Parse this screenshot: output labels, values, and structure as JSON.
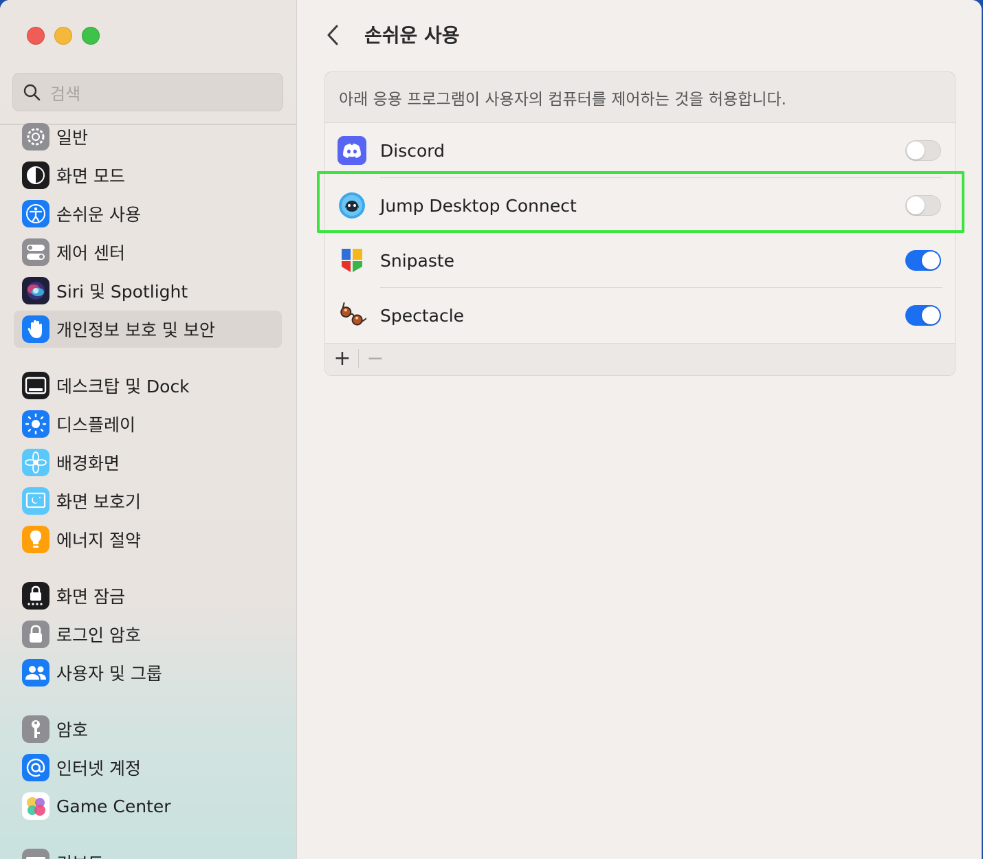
{
  "sidebar": {
    "search_placeholder": "검색",
    "items": [
      {
        "label": "일반",
        "icon": "gear-icon",
        "color": "#8e8e93"
      },
      {
        "label": "화면 모드",
        "icon": "appearance-icon",
        "color": "#1c1c1e"
      },
      {
        "label": "손쉬운 사용",
        "icon": "accessibility-icon",
        "color": "#1a7cf5"
      },
      {
        "label": "제어 센터",
        "icon": "control-center-icon",
        "color": "#8e8e93"
      },
      {
        "label": "Siri 및 Spotlight",
        "icon": "siri-icon",
        "color": "#2b2b5e"
      },
      {
        "label": "개인정보 보호 및 보안",
        "icon": "hand-icon",
        "color": "#1a7cf5",
        "selected": true
      },
      {
        "label": "데스크탑 및 Dock",
        "icon": "dock-icon",
        "color": "#1c1c1e"
      },
      {
        "label": "디스플레이",
        "icon": "display-icon",
        "color": "#1a7cf5"
      },
      {
        "label": "배경화면",
        "icon": "wallpaper-icon",
        "color": "#5ac8fa"
      },
      {
        "label": "화면 보호기",
        "icon": "screensaver-icon",
        "color": "#5ac8fa"
      },
      {
        "label": "에너지 절약",
        "icon": "energy-icon",
        "color": "#ff9f0a"
      },
      {
        "label": "화면 잠금",
        "icon": "lock-screen-icon",
        "color": "#1c1c1e"
      },
      {
        "label": "로그인 암호",
        "icon": "login-lock-icon",
        "color": "#8e8e93"
      },
      {
        "label": "사용자 및 그룹",
        "icon": "users-icon",
        "color": "#1a7cf5"
      },
      {
        "label": "암호",
        "icon": "key-icon",
        "color": "#8e8e93"
      },
      {
        "label": "인터넷 계정",
        "icon": "at-icon",
        "color": "#1a7cf5"
      },
      {
        "label": "Game Center",
        "icon": "game-center-icon",
        "color": "#ffffff"
      },
      {
        "label": "키보드",
        "icon": "keyboard-icon",
        "color": "#8e8e93"
      }
    ]
  },
  "main": {
    "title": "손쉬운 사용",
    "description": "아래 응용 프로그램이 사용자의 컴퓨터를 제어하는 것을 허용합니다.",
    "apps": [
      {
        "name": "Discord",
        "icon": "discord-icon",
        "enabled": false
      },
      {
        "name": "Jump Desktop Connect",
        "icon": "jump-desktop-icon",
        "enabled": false
      },
      {
        "name": "Snipaste",
        "icon": "snipaste-icon",
        "enabled": true
      },
      {
        "name": "Spectacle",
        "icon": "spectacle-icon",
        "enabled": true
      }
    ],
    "add_label": "+",
    "remove_label": "−"
  },
  "colors": {
    "accent": "#1b6ff0",
    "highlight": "#3de43f"
  }
}
